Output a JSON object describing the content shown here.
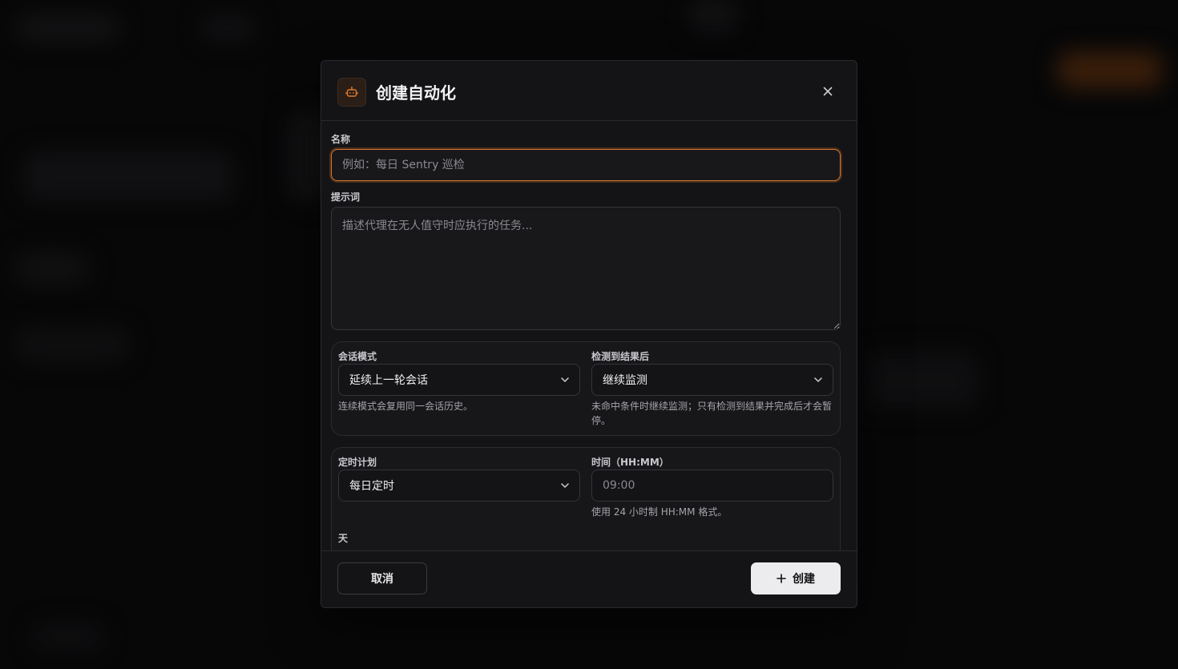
{
  "dialog": {
    "title": "创建自动化",
    "icon": "robot-icon",
    "accent_color": "#d9762c"
  },
  "form": {
    "name": {
      "label": "名称",
      "placeholder": "例如：每日 Sentry 巡检",
      "value": ""
    },
    "prompt": {
      "label": "提示词",
      "placeholder": "描述代理在无人值守时应执行的任务...",
      "value": ""
    },
    "session_mode": {
      "label": "会话模式",
      "selected": "延续上一轮会话",
      "hint": "连续模式会复用同一会话历史。"
    },
    "after_detect": {
      "label": "检测到结果后",
      "selected": "继续监测",
      "hint_line1": "未命中条件时继续监测；只有检测到结果并完成后才会暂",
      "hint_line2": "停。"
    },
    "schedule": {
      "label": "定时计划",
      "selected": "每日定时"
    },
    "time": {
      "label": "时间（HH:MM）",
      "placeholder": "09:00",
      "value": "",
      "hint": "使用 24 小时制 HH:MM 格式。"
    },
    "days": {
      "label": "天"
    }
  },
  "footer": {
    "cancel_label": "取消",
    "create_label": "创建"
  }
}
